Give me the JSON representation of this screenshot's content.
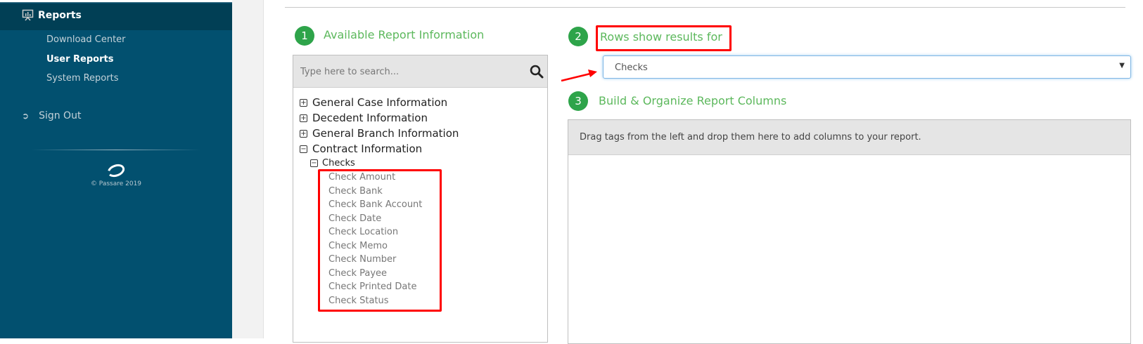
{
  "sidebar": {
    "reports_label": "Reports",
    "sub_items": [
      {
        "label": "Download Center"
      },
      {
        "label": "User Reports"
      },
      {
        "label": "System Reports"
      }
    ],
    "sign_out": "Sign Out",
    "copyright": "© Passare 2019"
  },
  "sections": {
    "s1": {
      "number": "1",
      "title": "Available Report Information"
    },
    "s2": {
      "number": "2",
      "title": "Rows show results for"
    },
    "s3": {
      "number": "3",
      "title": "Build & Organize Report Columns"
    }
  },
  "search": {
    "placeholder": "Type here to search..."
  },
  "tree": {
    "groups": [
      {
        "label": "General Case Information",
        "expanded": false
      },
      {
        "label": "Decedent Information",
        "expanded": false
      },
      {
        "label": "General Branch Information",
        "expanded": false
      },
      {
        "label": "Contract Information",
        "expanded": true
      }
    ],
    "subgroup": "Checks",
    "leaves": [
      "Check Amount",
      "Check Bank",
      "Check Bank Account",
      "Check Date",
      "Check Location",
      "Check Memo",
      "Check Number",
      "Check Payee",
      "Check Printed Date",
      "Check Status"
    ]
  },
  "rows_select": {
    "value": "Checks"
  },
  "drop_zone": {
    "hint": "Drag tags from the left and drop them here to add columns to your report."
  },
  "colors": {
    "sidebar": "#02506f",
    "accent_green": "#2ea44a",
    "annotation": "#ff0000"
  }
}
